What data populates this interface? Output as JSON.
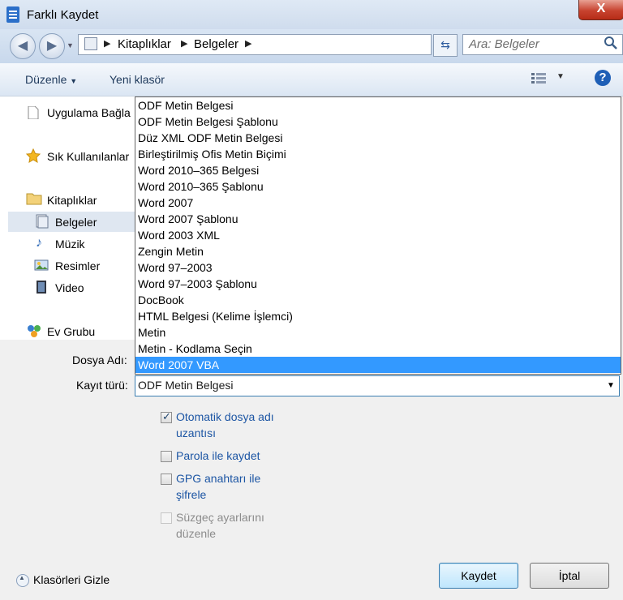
{
  "window": {
    "title": "Farklı Kaydet",
    "close_label": "X"
  },
  "address": {
    "crumbs": [
      "Kitaplıklar",
      "Belgeler"
    ],
    "search_placeholder": "Ara: Belgeler"
  },
  "toolbar": {
    "organize": "Düzenle",
    "new_folder": "Yeni klasör",
    "help": "?"
  },
  "nav": {
    "items": [
      "Uygulama Bağla",
      "Sık Kullanılanlar",
      "Kitaplıklar",
      "Belgeler",
      "Müzik",
      "Resimler",
      "Video",
      "Ev Grubu"
    ],
    "selected": "Belgeler"
  },
  "file_types": {
    "options": [
      "ODF Metin Belgesi",
      "ODF Metin Belgesi Şablonu",
      "Düz XML ODF Metin Belgesi",
      "Birleştirilmiş Ofis Metin Biçimi",
      "Word 2010–365 Belgesi",
      "Word 2010–365 Şablonu",
      "Word 2007",
      "Word 2007 Şablonu",
      "Word 2003 XML",
      "Zengin Metin",
      "Word 97–2003",
      "Word 97–2003 Şablonu",
      "DocBook",
      "HTML Belgesi (Kelime İşlemci)",
      "Metin",
      "Metin - Kodlama Seçin",
      "Word 2007 VBA"
    ],
    "highlighted": "Word 2007 VBA"
  },
  "form": {
    "filename_label": "Dosya Adı:",
    "type_label": "Kayıt türü:",
    "type_value": "ODF Metin Belgesi"
  },
  "options": {
    "auto_ext_1": "Otomatik dosya adı",
    "auto_ext_2": "uzantısı",
    "password": "Parola ile kaydet",
    "gpg_1": "GPG anahtarı ile",
    "gpg_2": "şifrele",
    "filter_1": "Süzgeç ayarlarını",
    "filter_2": "düzenle"
  },
  "footer": {
    "hide_folders": "Klasörleri Gizle",
    "save": "Kaydet",
    "cancel": "İptal"
  },
  "colors": {
    "highlight": "#3399ff",
    "link_text": "#1d56a4"
  }
}
